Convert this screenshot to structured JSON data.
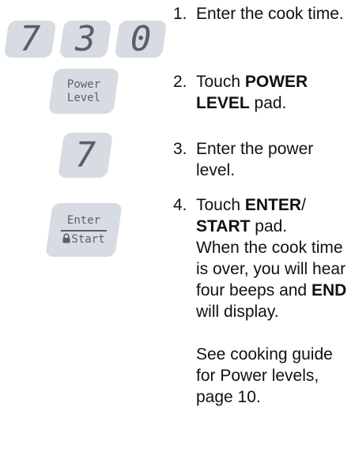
{
  "keypad": {
    "digits": [
      "7",
      "3",
      "0"
    ],
    "power_level": {
      "line1": "Power",
      "line2": "Level"
    },
    "power_digit": "7",
    "enter_start": {
      "line1": "Enter",
      "line2": "Start"
    }
  },
  "steps": [
    {
      "number": "1.",
      "pre": "Enter the cook time."
    },
    {
      "number": "2.",
      "pre": "Touch ",
      "bold": "POWER LEVEL",
      "post": " pad."
    },
    {
      "number": "3.",
      "pre": "Enter the power level."
    },
    {
      "number": "4.",
      "pre": "Touch ",
      "bold": "ENTER",
      "mid": "/ ",
      "bold2": "START",
      "post": " pad.",
      "detail_pre": "When the cook time is over, you will hear four beeps and ",
      "detail_bold": "END",
      "detail_post": " will display.",
      "note": "See cooking guide for Power levels, page 10."
    }
  ]
}
